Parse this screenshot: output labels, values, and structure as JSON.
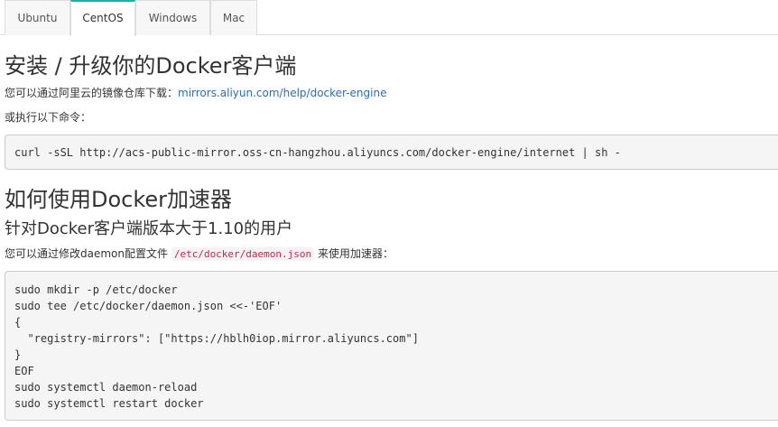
{
  "tabs": [
    {
      "label": "Ubuntu",
      "active": false
    },
    {
      "label": "CentOS",
      "active": true
    },
    {
      "label": "Windows",
      "active": false
    },
    {
      "label": "Mac",
      "active": false
    }
  ],
  "install": {
    "heading": "安装 / 升级你的Docker客户端",
    "mirror_text": "您可以通过阿里云的镜像仓库下载：",
    "mirror_link": "mirrors.aliyun.com/help/docker-engine",
    "or_text": "或执行以下命令：",
    "command": "curl -sSL http://acs-public-mirror.oss-cn-hangzhou.aliyuncs.com/docker-engine/internet | sh -"
  },
  "accelerator": {
    "heading": "如何使用Docker加速器",
    "subheading": "针对Docker客户端版本大于1.10的用户",
    "modify_prefix": "您可以通过修改daemon配置文件",
    "config_path": "/etc/docker/daemon.json",
    "modify_suffix": "来使用加速器：",
    "code_lines": [
      "sudo mkdir -p /etc/docker",
      "sudo tee /etc/docker/daemon.json <<-'EOF'",
      "{",
      "  \"registry-mirrors\": [\"https://hblh0iop.mirror.aliyuncs.com\"]",
      "}",
      "EOF",
      "sudo systemctl daemon-reload",
      "sudo systemctl restart docker"
    ]
  },
  "colors": {
    "accent": "#21b1a4",
    "link": "#2a6eb8",
    "inline_code": "#c7254e"
  }
}
